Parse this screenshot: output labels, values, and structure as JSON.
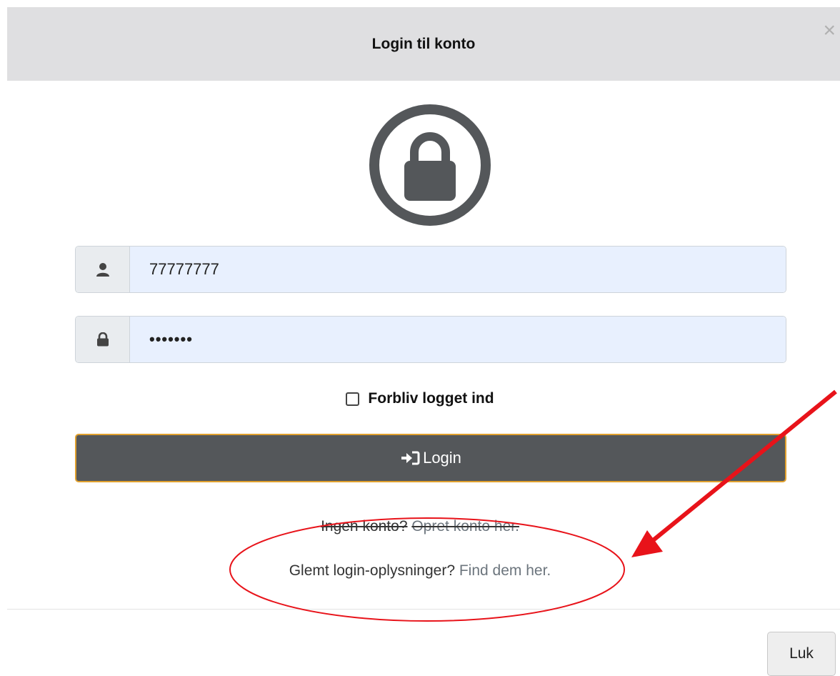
{
  "modal": {
    "title": "Login til konto",
    "close_symbol": "×"
  },
  "icons": {
    "header_lock": "lock-circle-icon",
    "user": "user-icon",
    "password": "lock-icon",
    "login": "sign-in-icon"
  },
  "form": {
    "username_value": "77777777",
    "password_value": "•••••••",
    "remember_label": "Forbliv logget ind",
    "remember_checked": false,
    "login_label": "Login"
  },
  "links": {
    "no_account_prefix": "Ingen konto?",
    "no_account_link": "Opret konto her.",
    "forgot_prefix": "Glemt login-oplysninger?",
    "forgot_link": "Find dem her."
  },
  "footer": {
    "close_label": "Luk"
  },
  "colors": {
    "header_bg": "#dfdfe1",
    "input_bg": "#e8f0fe",
    "button_bg": "#54575a",
    "button_border": "#e0a02e",
    "annotation": "#e8131a"
  }
}
